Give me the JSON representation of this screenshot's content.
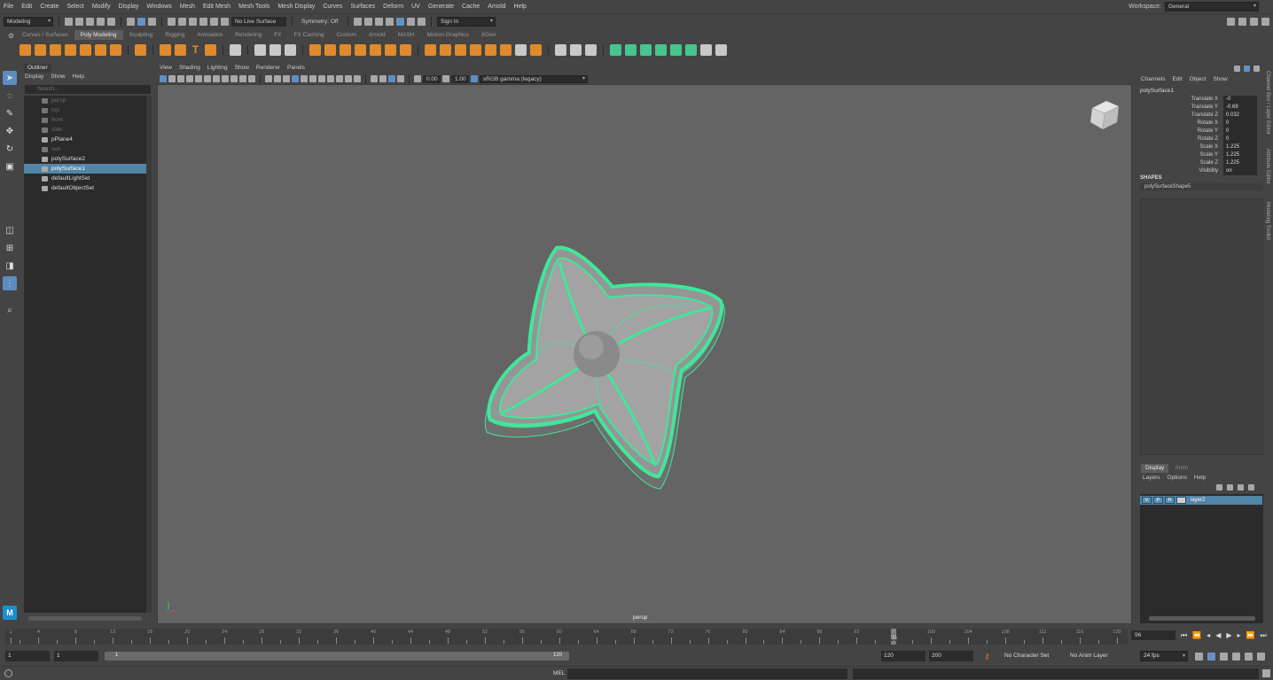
{
  "menubar": {
    "items": [
      "File",
      "Edit",
      "Create",
      "Select",
      "Modify",
      "Display",
      "Windows",
      "Mesh",
      "Edit Mesh",
      "Mesh Tools",
      "Mesh Display",
      "Curves",
      "Surfaces",
      "Deform",
      "UV",
      "Generate",
      "Cache",
      "Arnold",
      "Help"
    ],
    "workspace_label": "Workspace:",
    "workspace_value": "General"
  },
  "statusline": {
    "mode": "Modeling",
    "live_surface": "No Live Surface",
    "symmetry": "Symmetry: Off",
    "sign_in": "Sign In"
  },
  "shelf": {
    "tabs": [
      "Curves / Surfaces",
      "Poly Modeling",
      "Sculpting",
      "Rigging",
      "Animation",
      "Rendering",
      "FX",
      "FX Caching",
      "Custom",
      "Arnold",
      "MASH",
      "Motion Graphics",
      "XGen"
    ],
    "active_tab": "Poly Modeling"
  },
  "outliner": {
    "title": "Outliner",
    "menu": [
      "Display",
      "Show",
      "Help"
    ],
    "search_placeholder": "Search...",
    "items": [
      {
        "label": "persp",
        "dim": true
      },
      {
        "label": "top",
        "dim": true
      },
      {
        "label": "front",
        "dim": true
      },
      {
        "label": "side",
        "dim": true
      },
      {
        "label": "pPlane4",
        "dim": false
      },
      {
        "label": "sun",
        "dim": true
      },
      {
        "label": "polySurface2",
        "dim": false
      },
      {
        "label": "polySurface1",
        "dim": false,
        "selected": true
      },
      {
        "label": "defaultLightSet",
        "dim": false
      },
      {
        "label": "defaultObjectSet",
        "dim": false
      }
    ]
  },
  "viewport": {
    "menu": [
      "View",
      "Shading",
      "Lighting",
      "Show",
      "Renderer",
      "Panels"
    ],
    "exposure": "0.00",
    "gamma": "1.00",
    "color_space": "sRGB gamma (legacy)",
    "camera_label": "persp",
    "wire_color": "#3ee89a"
  },
  "channelbox": {
    "menu": [
      "Channels",
      "Edit",
      "Object",
      "Show"
    ],
    "object_name": "polySurface1",
    "attributes": [
      {
        "name": "Translate X",
        "value": "-0"
      },
      {
        "name": "Translate Y",
        "value": "-0.69"
      },
      {
        "name": "Translate Z",
        "value": "0.032"
      },
      {
        "name": "Rotate X",
        "value": "0"
      },
      {
        "name": "Rotate Y",
        "value": "0"
      },
      {
        "name": "Rotate Z",
        "value": "0"
      },
      {
        "name": "Scale X",
        "value": "1.225"
      },
      {
        "name": "Scale Y",
        "value": "1.225"
      },
      {
        "name": "Scale Z",
        "value": "1.225"
      },
      {
        "name": "Visibility",
        "value": "on"
      }
    ],
    "shapes_label": "SHAPES",
    "shape_name": "polySurfaceShape5",
    "side_tabs": [
      "Channel Box / Layer Editor",
      "Attribute Editor",
      "Modeling Toolkit"
    ]
  },
  "layers": {
    "tabs": [
      "Display",
      "Anim"
    ],
    "active_tab": "Display",
    "menu": [
      "Layers",
      "Options",
      "Help"
    ],
    "layer_flags": [
      "V",
      "P",
      "R"
    ],
    "layer_name": "layer2"
  },
  "timeline": {
    "start": 1,
    "end": 120,
    "current_frame": "96",
    "current_frame_field": "96",
    "labels": [
      "1",
      "4",
      "8",
      "12",
      "16",
      "20",
      "24",
      "28",
      "32",
      "36",
      "40",
      "44",
      "48",
      "52",
      "56",
      "60",
      "64",
      "68",
      "72",
      "76",
      "80",
      "84",
      "88",
      "92",
      "96",
      "100",
      "104",
      "108",
      "112",
      "116",
      "120"
    ]
  },
  "range": {
    "start_field": "1",
    "start_field2": "1",
    "slider_start": "1",
    "slider_end": "120",
    "end_field": "120",
    "end_field2": "200",
    "character_set": "No Character Set",
    "anim_layer": "No Anim Layer",
    "fps": "24 fps"
  },
  "cmdline": {
    "label": "MEL"
  }
}
